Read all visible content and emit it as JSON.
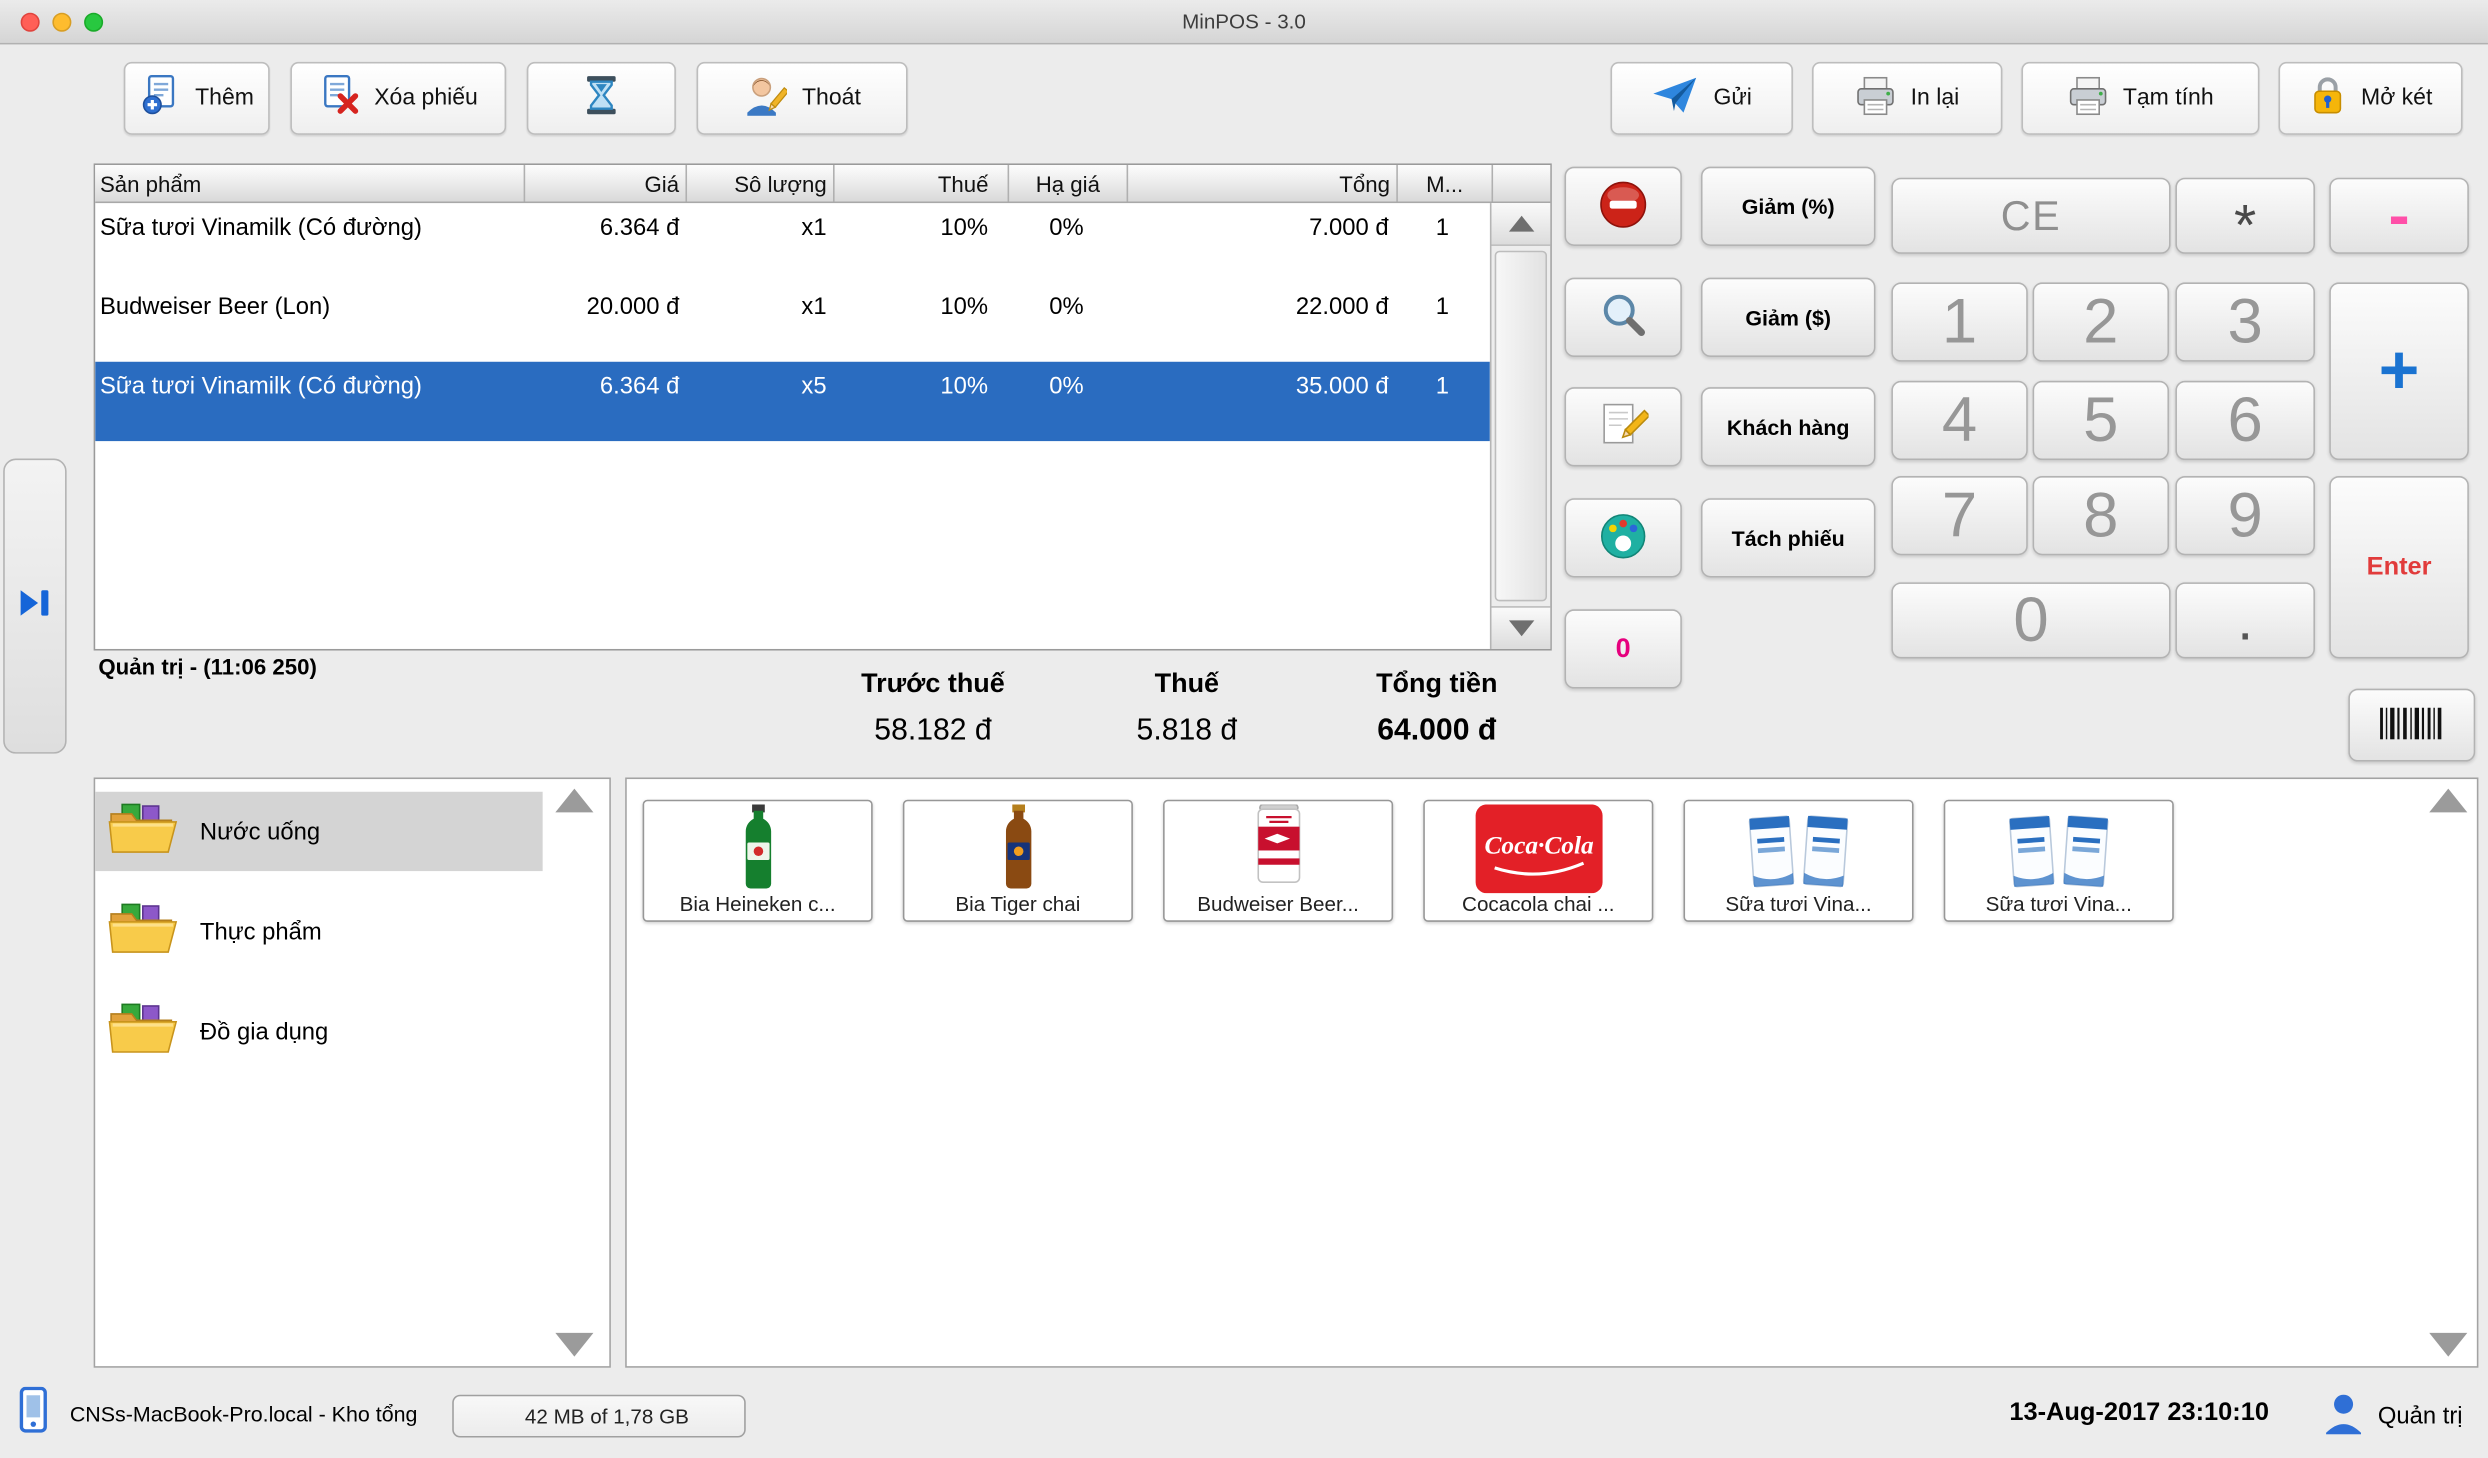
{
  "window": {
    "title": "MinPOS - 3.0"
  },
  "toolbar": {
    "left": [
      {
        "label": "Thêm",
        "icon": "add-document-icon"
      },
      {
        "label": "Xóa phiếu",
        "icon": "delete-receipt-icon"
      },
      {
        "label": "",
        "icon": "hourglass-icon"
      },
      {
        "label": "Thoát",
        "icon": "exit-user-icon"
      }
    ],
    "right": [
      {
        "label": "Gửi",
        "icon": "send-icon"
      },
      {
        "label": "In lại",
        "icon": "printer-icon"
      },
      {
        "label": "Tạm tính",
        "icon": "printer-icon"
      },
      {
        "label": "Mở két",
        "icon": "open-drawer-lock-icon"
      }
    ]
  },
  "order_table": {
    "columns": [
      "Sản phẩm",
      "Giá",
      "Sô lượng",
      "Thuế",
      "Hạ giá",
      "Tổng",
      "M..."
    ],
    "rows": [
      {
        "product": "Sữa tươi Vinamilk (Có đường)",
        "price": "6.364 đ",
        "qty": "x1",
        "tax": "10%",
        "discount": "0%",
        "total": "7.000 đ",
        "m": "1",
        "selected": false
      },
      {
        "product": "Budweiser Beer (Lon)",
        "price": "20.000 đ",
        "qty": "x1",
        "tax": "10%",
        "discount": "0%",
        "total": "22.000 đ",
        "m": "1",
        "selected": false
      },
      {
        "product": "Sữa tươi Vinamilk (Có đường)",
        "price": "6.364 đ",
        "qty": "x5",
        "tax": "10%",
        "discount": "0%",
        "total": "35.000 đ",
        "m": "1",
        "selected": true
      }
    ],
    "footer_note": "Quản trị - (11:06 250)"
  },
  "summary": {
    "pre_tax": {
      "label": "Trước thuế",
      "value": "58.182 đ"
    },
    "tax": {
      "label": "Thuế",
      "value": "5.818 đ"
    },
    "total": {
      "label": "Tổng tiền",
      "value": "64.000 đ"
    }
  },
  "actions": {
    "icon_buttons": [
      "remove-icon",
      "search-icon",
      "edit-icon",
      "palette-icon"
    ],
    "discount_percent": "Giảm (%)",
    "discount_amount": "Giảm ($)",
    "customer": "Khách hàng",
    "split_ticket": "Tách phiếu",
    "zero": "0"
  },
  "numpad": {
    "ce": "CE",
    "multiply": "*",
    "minus": "-",
    "plus": "+",
    "enter": "Enter",
    "dot": ".",
    "digits": [
      "1",
      "2",
      "3",
      "4",
      "5",
      "6",
      "7",
      "8",
      "9",
      "0"
    ]
  },
  "categories": [
    {
      "label": "Nước uống",
      "selected": true
    },
    {
      "label": "Thực phẩm",
      "selected": false
    },
    {
      "label": "Đồ gia dụng",
      "selected": false
    }
  ],
  "products": [
    {
      "label": "Bia Heineken c...",
      "image": "heineken-bottle"
    },
    {
      "label": "Bia Tiger chai",
      "image": "tiger-bottle"
    },
    {
      "label": "Budweiser Beer...",
      "image": "budweiser-can"
    },
    {
      "label": "Cocacola chai ...",
      "image": "cocacola-logo"
    },
    {
      "label": "Sữa tươi Vina...",
      "image": "vinamilk-cartons"
    },
    {
      "label": "Sữa tươi Vina...",
      "image": "vinamilk-cartons"
    }
  ],
  "statusbar": {
    "host": "CNSs-MacBook-Pro.local - Kho tổng",
    "memory": "42 MB of 1,78 GB",
    "datetime": "13-Aug-2017 23:10:10",
    "user": "Quản trị"
  },
  "colors": {
    "selected_row": "#2a6cc0",
    "plus_blue": "#1a73d1",
    "minus_pink": "#ff4fa8",
    "enter_red": "#e13b3b",
    "zero_magenta": "#e6007e"
  }
}
